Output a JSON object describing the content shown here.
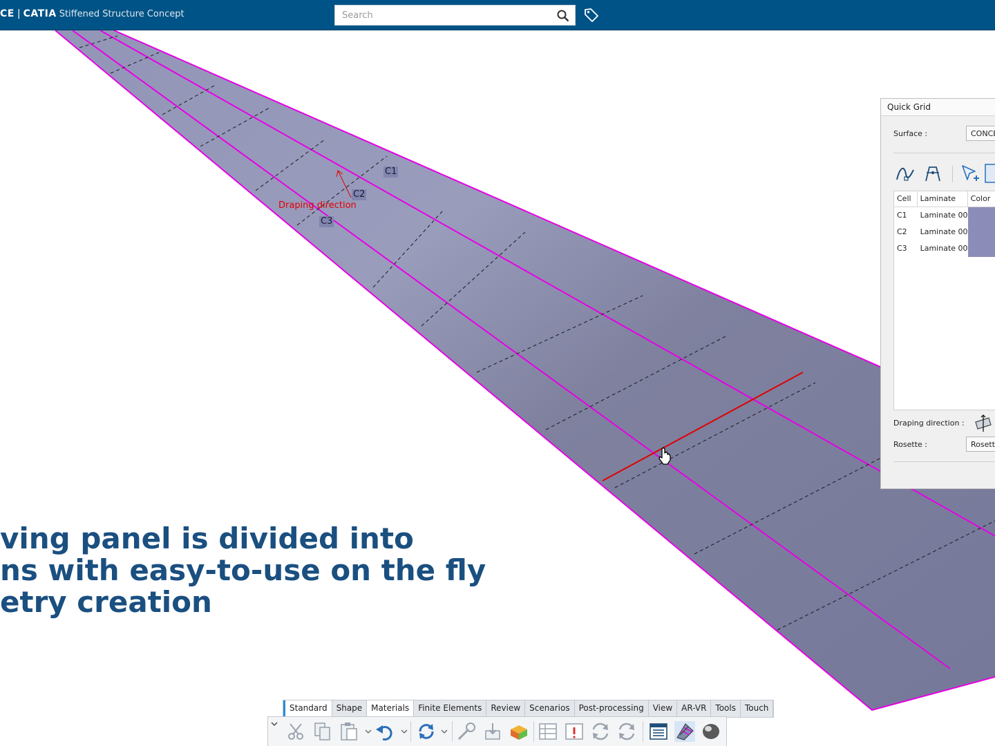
{
  "app": {
    "brand_prefix": "CE",
    "brand_name": "CATIA",
    "product": "Stiffened Structure Concept"
  },
  "search": {
    "placeholder": "Search"
  },
  "viewport": {
    "cell_labels": [
      "C1",
      "C2",
      "C3"
    ],
    "drape_label": "Draping direction"
  },
  "caption": {
    "line1": "ving panel is divided into",
    "line2": "ns with easy-to-use on the fly",
    "line3": "etry creation"
  },
  "panel": {
    "title": "Quick Grid",
    "surface_label": "Surface :",
    "surface_value": "CONCEPT",
    "columns": [
      "Cell",
      "Laminate",
      "Color"
    ],
    "rows": [
      {
        "cell": "C1",
        "laminate": "Laminate 00..."
      },
      {
        "cell": "C2",
        "laminate": "Laminate 00..."
      },
      {
        "cell": "C3",
        "laminate": "Laminate 00..."
      }
    ],
    "swatch_color": "#8c8cb8",
    "draping_label": "Draping direction :",
    "rosette_label": "Rosette :",
    "rosette_value": "Rosette"
  },
  "toolbar": {
    "tabs": [
      "Standard",
      "Shape",
      "Materials",
      "Finite Elements",
      "Review",
      "Scenarios",
      "Post-processing",
      "View",
      "AR-VR",
      "Tools",
      "Touch"
    ],
    "active_tab": "Standard"
  },
  "colors": {
    "header": "#005386",
    "panel_surface": "#7a7ca0",
    "boundary": "#e600e6",
    "highlight": "#e00000",
    "caption": "#1a4f80"
  }
}
